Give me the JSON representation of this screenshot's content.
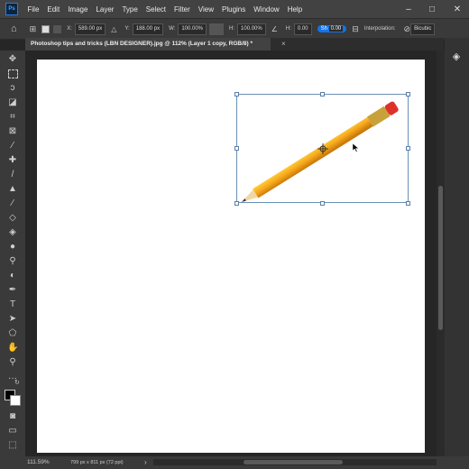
{
  "app": {
    "logo_text": "Ps"
  },
  "menu": [
    "File",
    "Edit",
    "Image",
    "Layer",
    "Type",
    "Select",
    "Filter",
    "View",
    "Plugins",
    "Window",
    "Help"
  ],
  "window_controls": {
    "minimize": "–",
    "maximize": "□",
    "close": "✕"
  },
  "options": {
    "x_label": "X:",
    "x_value": "589.00 px",
    "y_label": "Y:",
    "y_value": "188.00 px",
    "w_label": "W:",
    "w_value": "100.00%",
    "h_label": "H:",
    "h_value": "100.00%",
    "angle_label": "H:",
    "angle_value": "0.00",
    "sh_label": "Sh",
    "sh_value": "0.00",
    "interpolation_label": "Interpolation:",
    "interpolation_value": "Bicubic"
  },
  "document_tab": {
    "title": "Photoshop tips and tricks (LBN DESIGNER).jpg @ 112% (Layer 1 copy, RGB/8) *",
    "close": "×"
  },
  "status": {
    "zoom": "111.59%",
    "dimensions": "799 px x 811 px (72 ppi)",
    "arrow": "›"
  },
  "colors": {
    "accent": "#1473e6",
    "menubar": "#424242",
    "panel": "#3a3a3a",
    "canvas_bg": "#262626"
  }
}
